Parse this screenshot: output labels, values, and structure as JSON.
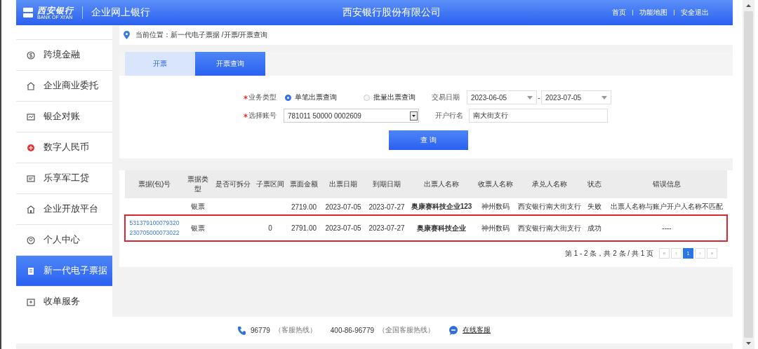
{
  "header": {
    "logo_cn": "西安银行",
    "logo_en": "BANK OF XI'AN",
    "product": "企业网上银行",
    "title": "西安银行股份有限公司",
    "links": [
      "首页",
      "功能地图",
      "安全退出"
    ]
  },
  "sidebar": {
    "items": [
      {
        "label": "跨境金融",
        "selected": false
      },
      {
        "label": "企业商业委托",
        "selected": false
      },
      {
        "label": "银企对账",
        "selected": false
      },
      {
        "label": "数字人民币",
        "selected": false
      },
      {
        "label": "乐享军工贷",
        "selected": false
      },
      {
        "label": "企业开放平台",
        "selected": false
      },
      {
        "label": "个人中心",
        "selected": false
      },
      {
        "label": "新一代电子票据",
        "selected": true
      },
      {
        "label": "收单服务",
        "selected": false
      }
    ]
  },
  "breadcrumb": "当前位置：新一代电子票据 /开票/开票查询",
  "tabs": [
    {
      "label": "开票",
      "selected": false
    },
    {
      "label": "开票查询",
      "selected": true
    }
  ],
  "form": {
    "business_type": {
      "label": "业务类型",
      "required": true,
      "options": [
        {
          "label": "单笔出票查询",
          "selected": true
        },
        {
          "label": "批量出票查询",
          "selected": false
        }
      ]
    },
    "trade_date": {
      "label": "交易日期",
      "from": "2023-06-05",
      "separator": "-",
      "to": "2023-07-05"
    },
    "account": {
      "label": "选择账号",
      "required": true,
      "value": "781011 50000 0002609"
    },
    "bank_name": {
      "label": "开户行名",
      "value": "南大街支行"
    },
    "query_button": "查 询"
  },
  "table": {
    "columns": [
      "票据(包)号",
      "票据类型",
      "是否可拆分",
      "子票区间",
      "票面金额",
      "出票日期",
      "到期日期",
      "出票人名称",
      "收票人名称",
      "承兑人名称",
      "状态",
      "错误信息"
    ],
    "rows": [
      {
        "highlighted": false,
        "cells": [
          "",
          "银票",
          "",
          "",
          "2719.00",
          "2023-07-05",
          "2023-07-27",
          "奥康赛科技企业123",
          "神州数码",
          "西安银行南大街支行",
          "失败",
          "出票人名称与账户开户人名称不匹配"
        ]
      },
      {
        "highlighted": true,
        "cells": [
          "531379100079320230705000073022",
          "银票",
          "",
          "0",
          "2791.00",
          "2023-07-05",
          "2023-07-27",
          "奥康赛科技企业",
          "神州数码",
          "西安银行南大街支行",
          "成功",
          "----"
        ]
      }
    ]
  },
  "pagination": {
    "summary": "第 1 - 2 条，共 2 条 / 共 1 页",
    "pages": [
      {
        "label": "«",
        "selected": false
      },
      {
        "label": "‹",
        "selected": false
      },
      {
        "label": "1",
        "selected": true
      },
      {
        "label": "›",
        "selected": false
      },
      {
        "label": "»",
        "selected": false
      }
    ]
  },
  "footer": {
    "hotline": "96779",
    "hotline_note": "（客服热线）",
    "national": "400-86-96779",
    "national_note": "（全国客服热线）",
    "online": "在线客服"
  }
}
